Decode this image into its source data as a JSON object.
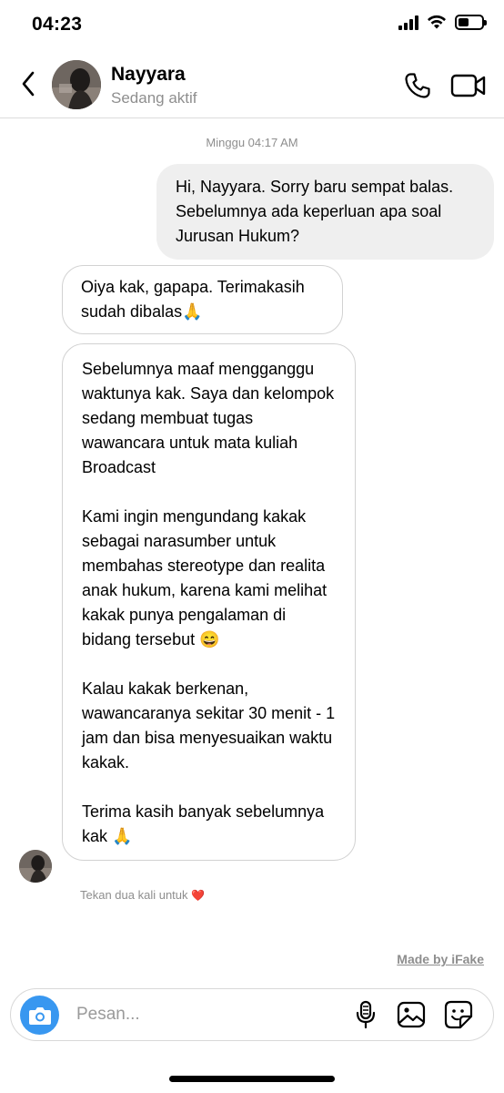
{
  "status_bar": {
    "time": "04:23",
    "battery_level": 0.45
  },
  "header": {
    "contact_name": "Nayyara",
    "contact_status": "Sedang aktif"
  },
  "chat": {
    "timestamp": "Minggu 04:17 AM",
    "outgoing": {
      "text": "Hi, Nayyara. Sorry baru sempat balas. Sebelumnya ada keperluan apa soal Jurusan Hukum?"
    },
    "incoming_1": {
      "text": "Oiya kak, gapapa. Terimakasih sudah dibalas🙏"
    },
    "incoming_2": {
      "para_1": "Sebelumnya maaf mengganggu waktunya kak. Saya dan kelompok sedang membuat tugas wawancara untuk mata kuliah Broadcast",
      "para_2": "Kami ingin mengundang kakak sebagai narasumber untuk membahas stereotype dan realita anak hukum, karena kami melihat kakak punya pengalaman di bidang tersebut 😄",
      "para_3": "Kalau kakak berkenan, wawancaranya sekitar 30 menit - 1 jam dan bisa menyesuaikan waktu kakak.",
      "para_4": "Terima kasih banyak sebelumnya kak 🙏"
    },
    "hint": "Tekan dua kali untuk",
    "hint_icon": "❤️"
  },
  "watermark": "Made by iFake",
  "composer": {
    "placeholder": "Pesan..."
  },
  "icons": {
    "back": "chevron-left-icon",
    "call": "phone-icon",
    "video": "video-camera-icon",
    "camera": "camera-icon",
    "mic": "microphone-icon",
    "gallery": "image-icon",
    "sticker": "sticker-icon"
  },
  "colors": {
    "accent": "#3897f0",
    "bubble_out": "#efefef",
    "muted": "#8e8e8e"
  }
}
